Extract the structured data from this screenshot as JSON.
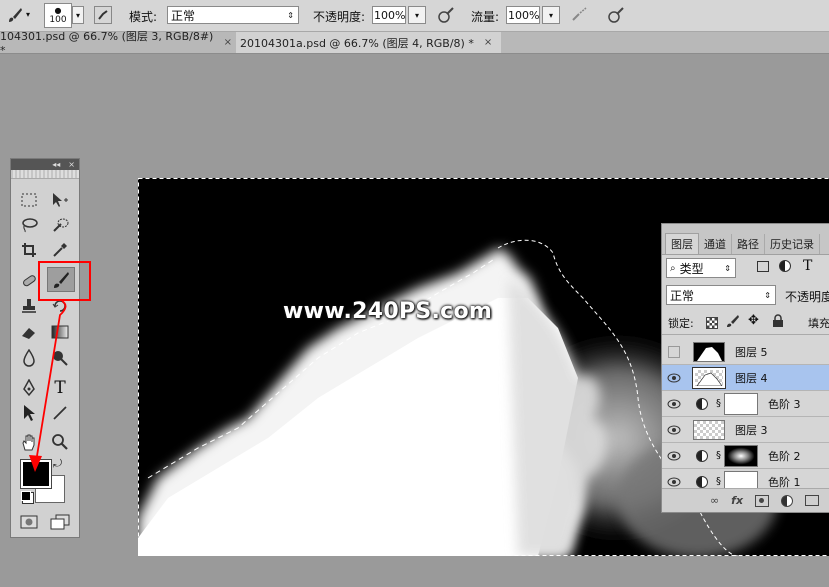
{
  "options_bar": {
    "brush_size": "100",
    "mode_label": "模式:",
    "mode_value": "正常",
    "opacity_label": "不透明度:",
    "opacity_value": "100%",
    "flow_label": "流量:",
    "flow_value": "100%"
  },
  "doc_tabs": [
    {
      "label": "104301.psd @ 66.7% (图层 3, RGB/8#) *",
      "close": "×"
    },
    {
      "label": "20104301a.psd @ 66.7% (图层 4, RGB/8) *",
      "close": "×"
    }
  ],
  "toolbox": {
    "collapse": "◂◂",
    "close": "×",
    "type_tool": "T"
  },
  "watermark": "www.240PS.com",
  "layers_panel": {
    "tabs": [
      "图层",
      "通道",
      "路径",
      "历史记录"
    ],
    "filter_kind": "类型",
    "blend_mode": "正常",
    "opacity_label": "不透明度",
    "lock_label": "锁定:",
    "fill_label": "填充",
    "type_icon": "T",
    "layers": [
      {
        "name": "图层 5",
        "visible": false,
        "thumb": "mountain"
      },
      {
        "name": "图层 4",
        "visible": true,
        "thumb": "mountain-selected",
        "selected": true
      },
      {
        "name": "色阶 3",
        "visible": true,
        "thumb": "white-mask",
        "adjustment": true
      },
      {
        "name": "图层 3",
        "visible": true,
        "thumb": "transparent"
      },
      {
        "name": "色阶 2",
        "visible": true,
        "thumb": "glow-mask",
        "adjustment": true
      },
      {
        "name": "色阶 1",
        "visible": true,
        "thumb": "white-mask",
        "adjustment": true
      }
    ],
    "bottom": [
      "link-icon",
      "fx",
      "mask-icon",
      "adjustment-icon",
      "folder-icon"
    ],
    "fx_label": "fx"
  },
  "colors": {
    "foreground": "#000000",
    "background": "#ffffff",
    "annotation": "#ff0000",
    "layer_selected": "#a8c4ee"
  }
}
